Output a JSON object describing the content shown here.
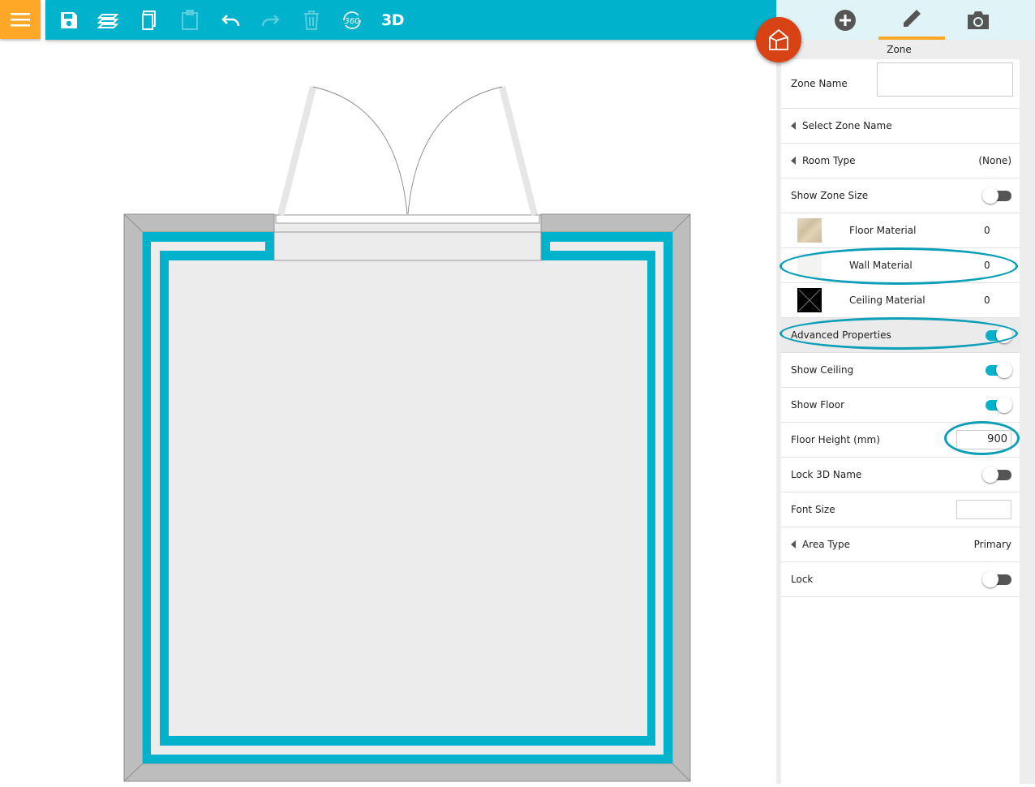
{
  "toolbar": {
    "btn_3d_label": "3D",
    "btn_360_label": "360"
  },
  "panel": {
    "title": "Zone",
    "rows": {
      "zone_name": "Zone Name",
      "zone_name_value": "",
      "select_zone_name": "Select Zone Name",
      "room_type": "Room Type",
      "room_type_value": "(None)",
      "show_zone_size": "Show Zone Size",
      "floor_material": "Floor Material",
      "floor_material_value": "0",
      "wall_material": "Wall Material",
      "wall_material_value": "0",
      "ceiling_material": "Ceiling Material",
      "ceiling_material_value": "0",
      "advanced_properties": "Advanced Properties",
      "show_ceiling": "Show Ceiling",
      "show_floor": "Show Floor",
      "floor_height": "Floor Height (mm)",
      "floor_height_value": "900",
      "lock_3d_name": "Lock 3D Name",
      "font_size": "Font Size",
      "font_size_value": "",
      "area_type": "Area Type",
      "area_type_value": "Primary",
      "lock": "Lock"
    },
    "toggles": {
      "show_zone_size": false,
      "advanced_properties": true,
      "show_ceiling": true,
      "show_floor": true,
      "lock_3d_name": false,
      "lock": false
    }
  },
  "colors": {
    "accent": "#00b2cc",
    "menu": "#ffa726",
    "fab": "#d84315",
    "highlight_oval": "#0d9fb8"
  },
  "icons": {
    "menu": "hamburger-icon",
    "save": "save-icon",
    "layers": "layers-icon",
    "copy": "copy-icon",
    "paste": "paste-icon",
    "undo": "undo-icon",
    "redo": "redo-icon",
    "delete": "trash-icon",
    "view360": "360-view-icon",
    "fab": "house-icon",
    "add": "add-circle-icon",
    "edit": "pencil-icon",
    "camera": "camera-icon"
  }
}
